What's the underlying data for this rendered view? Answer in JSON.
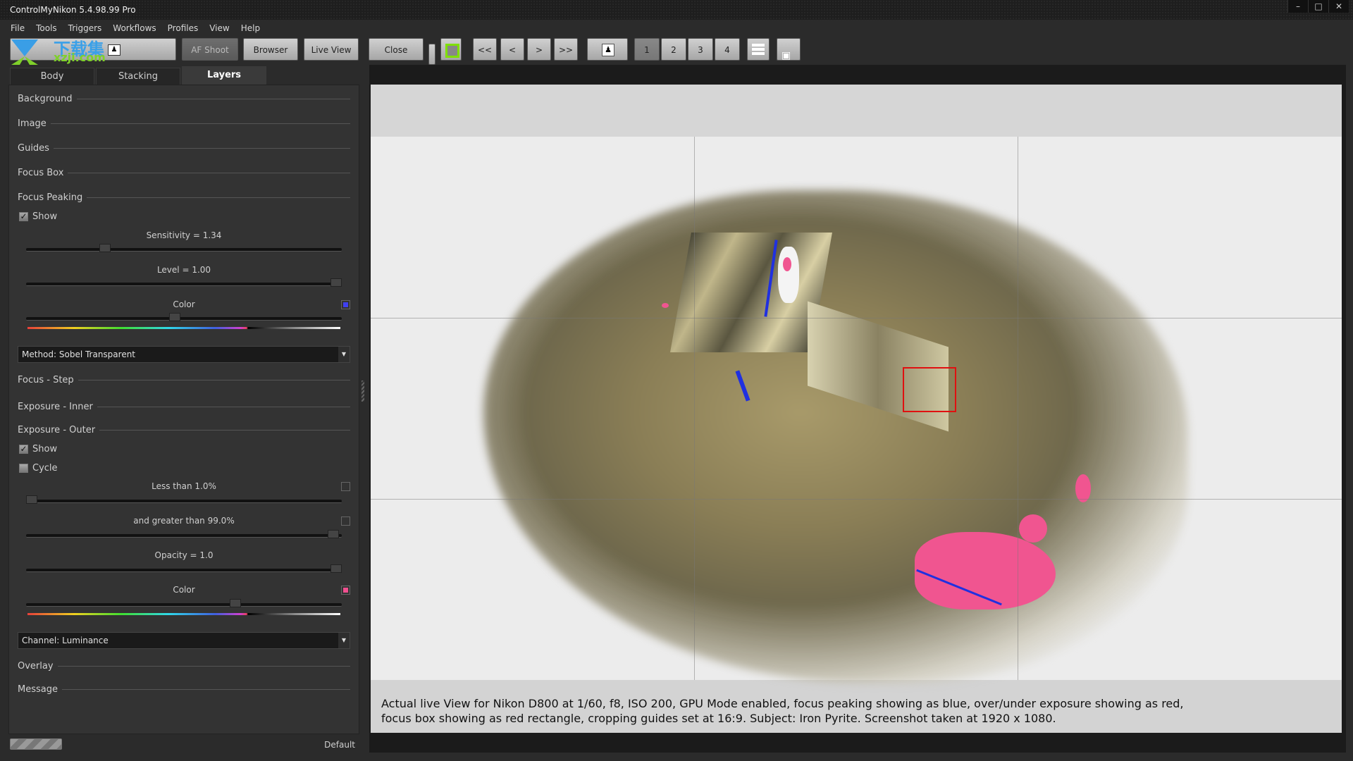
{
  "window": {
    "title": "ControlMyNikon 5.4.98.99 Pro",
    "controls": {
      "minimize": "–",
      "maximize": "□",
      "close": "✕"
    }
  },
  "menu": [
    "File",
    "Tools",
    "Triggers",
    "Workflows",
    "Profiles",
    "View",
    "Help"
  ],
  "watermark": {
    "text": "下载集",
    "sub": "xzji.com"
  },
  "toolbar": {
    "af_shoot": "AF Shoot",
    "browser": "Browser",
    "live_view": "Live View",
    "close": "Close",
    "first": "<<",
    "prev": "<",
    "next": ">",
    "last": ">>",
    "pages": [
      "1",
      "2",
      "3",
      "4"
    ],
    "selected_page": "1",
    "overlay_toggle_color": "#7fe000"
  },
  "panel": {
    "tabs": [
      {
        "label": "Body",
        "active": false
      },
      {
        "label": "Stacking",
        "active": false
      },
      {
        "label": "Layers",
        "active": true
      }
    ],
    "sections": {
      "background": "Background",
      "image": "Image",
      "guides": "Guides",
      "focus_box": "Focus Box",
      "focus_peaking": "Focus Peaking",
      "focus_step": "Focus - Step",
      "exposure_inner": "Exposure - Inner",
      "exposure_outer": "Exposure - Outer",
      "overlay": "Overlay",
      "message": "Message"
    },
    "focus_peaking": {
      "show_label": "Show",
      "show": true,
      "sensitivity_label": "Sensitivity = 1.34",
      "sensitivity_fraction": 0.24,
      "level_label": "Level = 1.00",
      "level_fraction": 1.0,
      "color_label": "Color",
      "color": "#4040f0",
      "color_fraction": 0.47,
      "method": "Method: Sobel Transparent"
    },
    "exposure_outer": {
      "show_label": "Show",
      "show": true,
      "cycle_label": "Cycle",
      "cycle": false,
      "less_than_label": "Less than 1.0%",
      "less_than_enabled": false,
      "less_than_fraction": 0.0,
      "greater_than_label": "and greater than 99.0%",
      "greater_than_enabled": false,
      "greater_than_fraction": 0.99,
      "opacity_label": "Opacity = 1.0",
      "opacity_fraction": 1.0,
      "color_label": "Color",
      "color": "#f05090",
      "color_fraction": 0.67,
      "channel": "Channel: Luminance"
    },
    "profile": "Default"
  },
  "live_view": {
    "caption_line1": "Actual live View for Nikon D800 at 1/60, f8, ISO 200, GPU Mode enabled, focus peaking showing as blue, over/under exposure showing as red,",
    "caption_line2": "focus box showing as red rectangle, cropping guides set at 16:9.  Subject: Iron Pyrite.  Screenshot taken at 1920 x 1080.",
    "focus_box_color": "#e01010",
    "peaking_color": "#2030e0",
    "exposure_color": "#f05590"
  }
}
